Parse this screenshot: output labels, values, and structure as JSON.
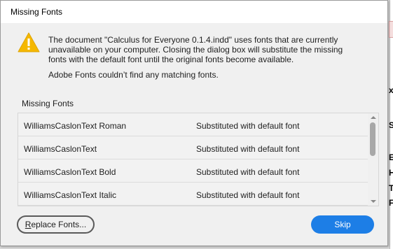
{
  "window": {
    "title": "Missing Fonts"
  },
  "message": {
    "line1": "The document \"Calculus for Everyone  0.1.4.indd\" uses fonts that are currently",
    "line2": "unavailable on your computer. Closing the dialog box will substitute the missing",
    "line3": "fonts with the default font until the original fonts become available.",
    "adobe_fonts": "Adobe Fonts couldn’t find any matching fonts."
  },
  "list": {
    "label": "Missing Fonts",
    "rows": [
      {
        "name": "WilliamsCaslonText Roman",
        "status": "Substituted with default font"
      },
      {
        "name": "WilliamsCaslonText",
        "status": "Substituted with default font"
      },
      {
        "name": "WilliamsCaslonText Bold",
        "status": "Substituted with default font"
      },
      {
        "name": "WilliamsCaslonText Italic",
        "status": "Substituted with default font"
      }
    ]
  },
  "buttons": {
    "replace_prefix": "R",
    "replace_rest": "eplace Fonts...",
    "skip": "Skip"
  },
  "background": {
    "fragments": [
      "x",
      "S",
      "E",
      "H",
      "T",
      "F"
    ]
  },
  "colors": {
    "accent": "#1d7ee6",
    "warning": "#f5b800"
  },
  "icons": {
    "warning": "warning-icon"
  }
}
